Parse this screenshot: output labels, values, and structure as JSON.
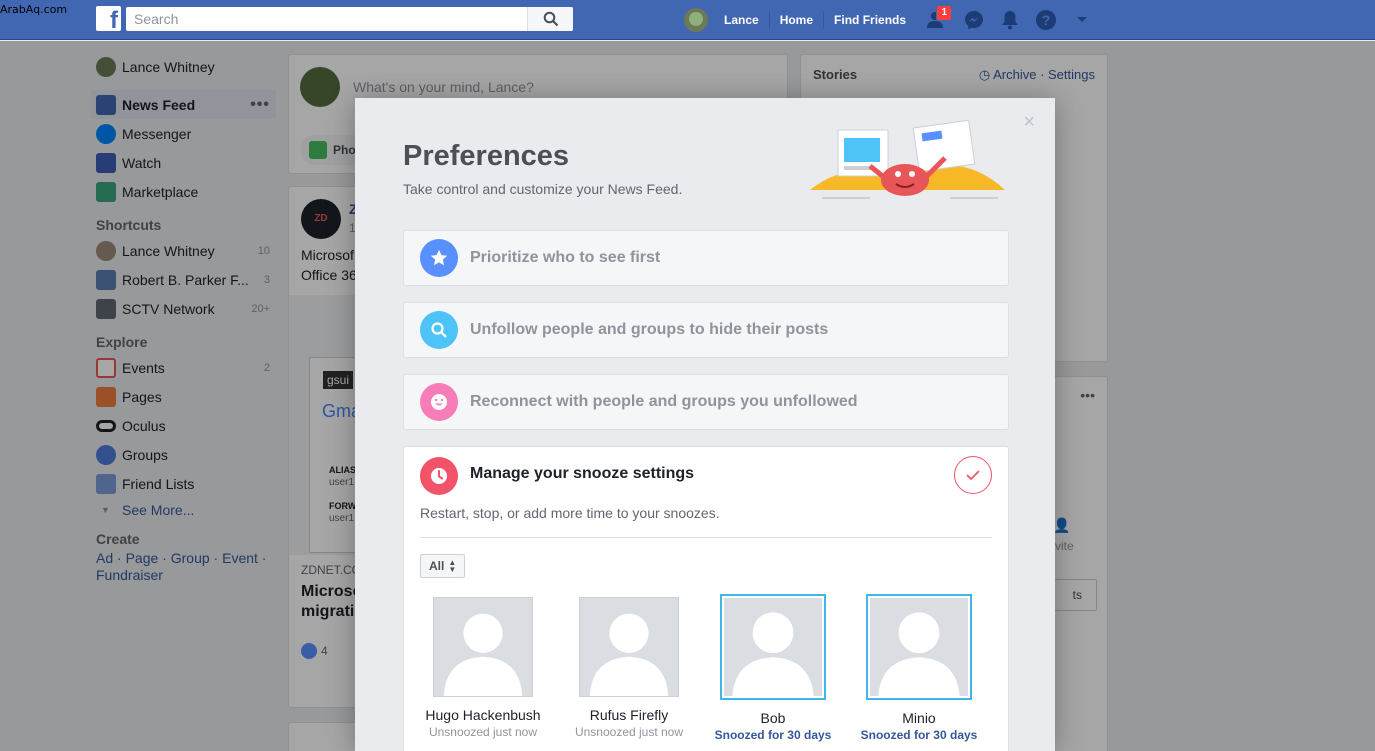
{
  "watermark": "ArabAq.com",
  "topbar": {
    "search_placeholder": "Search",
    "user_name": "Lance",
    "home_label": "Home",
    "find_friends_label": "Find Friends",
    "friend_requests_badge": "1"
  },
  "sidebar": {
    "profile_name": "Lance Whitney",
    "items": [
      {
        "label": "News Feed"
      },
      {
        "label": "Messenger"
      },
      {
        "label": "Watch"
      },
      {
        "label": "Marketplace"
      }
    ],
    "shortcuts_heading": "Shortcuts",
    "shortcuts": [
      {
        "label": "Lance Whitney",
        "count": "10"
      },
      {
        "label": "Robert B. Parker F...",
        "count": "3"
      },
      {
        "label": "SCTV Network",
        "count": "20+"
      }
    ],
    "explore_heading": "Explore",
    "explore": [
      {
        "label": "Events",
        "count": "2"
      },
      {
        "label": "Pages"
      },
      {
        "label": "Oculus"
      },
      {
        "label": "Groups"
      },
      {
        "label": "Friend Lists"
      }
    ],
    "see_more": "See More...",
    "create_heading": "Create",
    "create_links": [
      "Ad",
      "Page",
      "Group",
      "Event",
      "Fundraiser"
    ]
  },
  "composer": {
    "placeholder": "What's on your mind, Lance?",
    "photo_label": "Pho"
  },
  "feed_post": {
    "author_initial": "Z",
    "time_fragment": "1",
    "text_line1": "Microsof",
    "text_line2": "Office 36",
    "source": "ZDNET.CO",
    "headline_line1": "Microso",
    "headline_line2": "migratio",
    "reactions": "4",
    "email_label1": "ALIAS",
    "email_val1": "user1",
    "email_label2": "FORW",
    "email_val2": "user1",
    "gsuite_label": "gsui",
    "gmail_label": "Gma"
  },
  "stories": {
    "title": "Stories",
    "archive": "Archive",
    "settings": "Settings"
  },
  "right_fragments": {
    "invite": "vite",
    "button_fragment": "ts"
  },
  "modal": {
    "title": "Preferences",
    "subtitle": "Take control and customize your News Feed.",
    "options": [
      {
        "label": "Prioritize who to see first",
        "color": "#5890ff"
      },
      {
        "label": "Unfollow people and groups to hide their posts",
        "color": "#4dc3f7"
      },
      {
        "label": "Reconnect with people and groups you unfollowed",
        "color": "#f77db8"
      }
    ],
    "snooze": {
      "title": "Manage your snooze settings",
      "description": "Restart, stop, or add more time to your snoozes.",
      "filter": "All",
      "people": [
        {
          "name": "Hugo Hackenbush",
          "status": "Unsnoozed just now",
          "selected": false
        },
        {
          "name": "Rufus Firefly",
          "status": "Unsnoozed just now",
          "selected": false
        },
        {
          "name": "Bob",
          "status": "Snoozed for 30 days",
          "selected": true
        },
        {
          "name": "Minio",
          "status": "Snoozed for 30 days",
          "selected": true
        }
      ]
    }
  }
}
